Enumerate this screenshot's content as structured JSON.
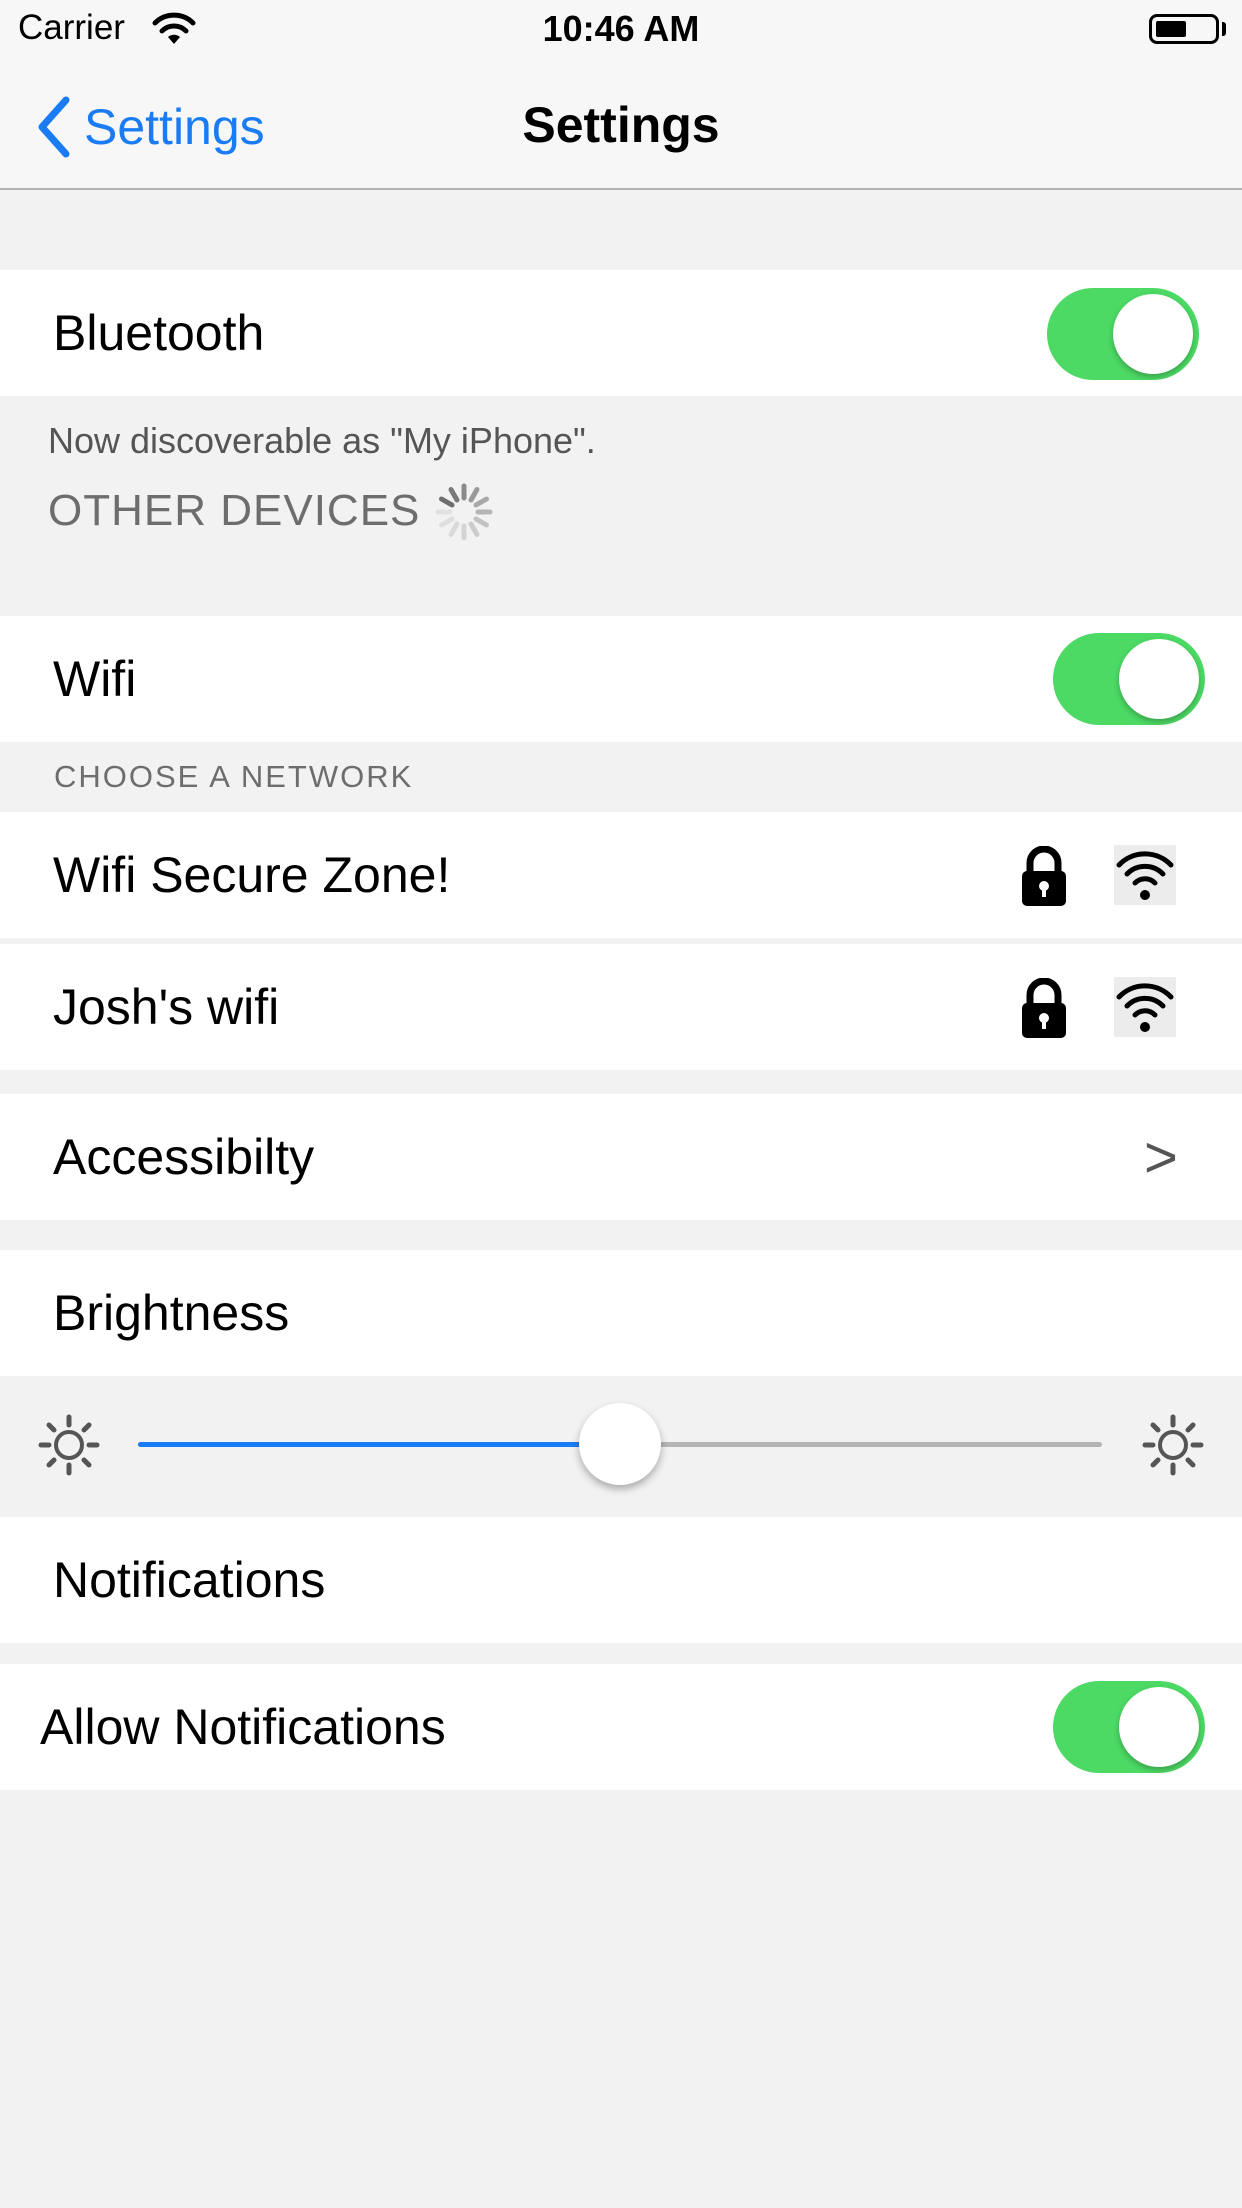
{
  "status_bar": {
    "carrier": "Carrier",
    "time": "10:46 AM"
  },
  "nav": {
    "back_label": "Settings",
    "title": "Settings"
  },
  "bluetooth": {
    "label": "Bluetooth",
    "enabled": true,
    "discoverable_note": "Now discoverable as \"My iPhone\".",
    "other_devices_header": "OTHER DEVICES"
  },
  "wifi": {
    "label": "Wifi",
    "enabled": true,
    "choose_header": "CHOOSE A NETWORK",
    "networks": [
      {
        "name": "Wifi Secure Zone!",
        "icons": [
          "lock-icon",
          "wifi-signal-icon"
        ]
      },
      {
        "name": "Josh's wifi",
        "icons": [
          "lock-icon",
          "wifi-signal-icon"
        ]
      }
    ]
  },
  "accessibility": {
    "label": "Accessibilty",
    "chevron": ">"
  },
  "brightness": {
    "label": "Brightness",
    "value": 0.5,
    "min_icon": "sun-icon",
    "max_icon": "sun-icon"
  },
  "notifications": {
    "label": "Notifications",
    "allow_label": "Allow Notifications",
    "allow_enabled": true
  },
  "colors": {
    "accent": "#1a7cf5",
    "toggle_on": "#4cd964",
    "background": "#f2f2f2"
  }
}
